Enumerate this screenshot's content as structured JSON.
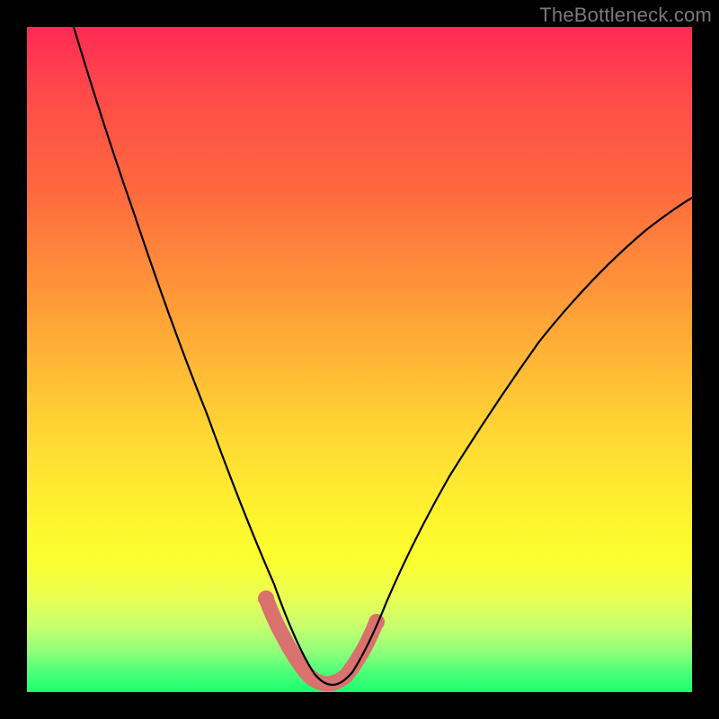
{
  "watermark": {
    "text": "TheBottleneck.com"
  },
  "chart_data": {
    "type": "line",
    "title": "",
    "xlabel": "",
    "ylabel": "",
    "xlim": [
      0,
      100
    ],
    "ylim": [
      0,
      100
    ],
    "series": [
      {
        "name": "bottleneck-curve",
        "x": [
          7,
          10,
          14,
          18,
          22,
          26,
          29,
          32,
          34,
          36,
          38,
          40,
          42,
          44,
          46,
          48,
          52,
          56,
          60,
          64,
          68,
          72,
          76,
          80,
          84,
          88,
          92,
          96,
          100
        ],
        "values": [
          100,
          90,
          78,
          67,
          56,
          46,
          36,
          27,
          20,
          14,
          9,
          5,
          2,
          1,
          1,
          2,
          5,
          10,
          16,
          22,
          29,
          35,
          42,
          48,
          53,
          59,
          64,
          68,
          72
        ]
      },
      {
        "name": "flat-minimum-band",
        "x": [
          36,
          38,
          40,
          42,
          44,
          46,
          48,
          50
        ],
        "values": [
          14,
          9,
          5,
          2,
          1,
          1,
          2,
          4
        ]
      }
    ],
    "colors": {
      "curve": "#000000",
      "band": "#d9716e",
      "gradient_top": "#ff2a55",
      "gradient_mid": "#ffd933",
      "gradient_bottom": "#1bff70"
    }
  }
}
